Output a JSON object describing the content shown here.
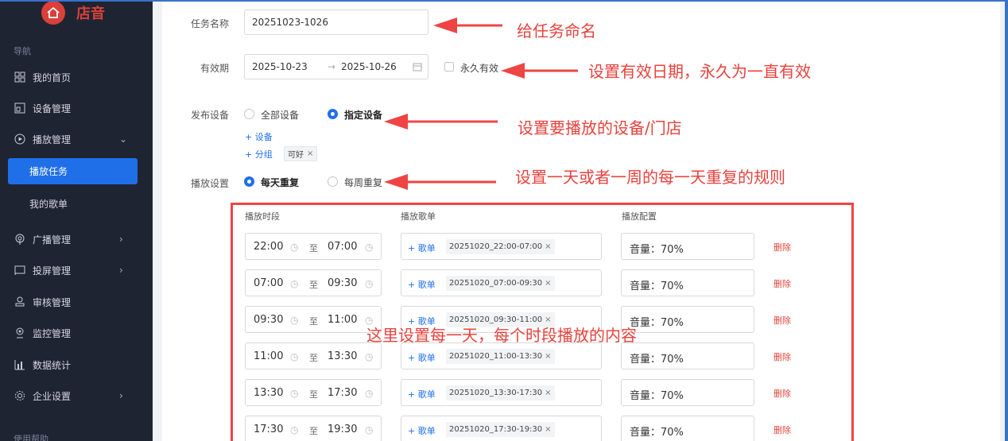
{
  "app": {
    "name": "店音"
  },
  "sidebar": {
    "section_nav": "导航",
    "items": [
      {
        "label": "我的首页",
        "icon": "grid-icon"
      },
      {
        "label": "设备管理",
        "icon": "device-icon"
      },
      {
        "label": "播放管理",
        "icon": "play-circle-icon",
        "arrow": "⌄"
      },
      {
        "label": "广播管理",
        "icon": "broadcast-icon",
        "arrow": "›"
      },
      {
        "label": "投屏管理",
        "icon": "cast-icon",
        "arrow": "›"
      },
      {
        "label": "审核管理",
        "icon": "stamp-icon"
      },
      {
        "label": "监控管理",
        "icon": "location-icon"
      },
      {
        "label": "数据统计",
        "icon": "bar-chart-icon"
      },
      {
        "label": "企业设置",
        "icon": "gear-icon",
        "arrow": "›"
      }
    ],
    "sub_active": "播放任务",
    "sub_other": "我的歌单",
    "section_help": "使用帮助"
  },
  "form": {
    "task_name_label": "任务名称",
    "task_name_value": "20251023-1026",
    "validity_label": "有效期",
    "date_start": "2025-10-23",
    "date_sep": "→",
    "date_end": "2025-10-26",
    "permanent_label": "永久有效",
    "publish_label": "发布设备",
    "all_devices": "全部设备",
    "specific_devices": "指定设备",
    "add_device": "+ 设备",
    "add_group": "+ 分组",
    "group_tag": "可好",
    "play_setting_label": "播放设置",
    "daily_repeat": "每天重复",
    "weekly_repeat": "每周重复"
  },
  "schedule": {
    "col_time": "播放时段",
    "col_playlist": "播放歌单",
    "col_config": "播放配置",
    "to": "至",
    "add_playlist": "+ 歌单",
    "delete": "删除",
    "rows": [
      {
        "start": "22:00",
        "end": "07:00",
        "playlist": "20251020_22:00-07:00",
        "volume": "音量：70%"
      },
      {
        "start": "07:00",
        "end": "09:30",
        "playlist": "20251020_07:00-09:30",
        "volume": "音量：70%"
      },
      {
        "start": "09:30",
        "end": "11:00",
        "playlist": "20251020_09:30-11:00",
        "volume": "音量：70%"
      },
      {
        "start": "11:00",
        "end": "13:30",
        "playlist": "20251020_11:00-13:30",
        "volume": "音量：70%"
      },
      {
        "start": "13:30",
        "end": "17:30",
        "playlist": "20251020_13:30-17:30",
        "volume": "音量：70%"
      },
      {
        "start": "17:30",
        "end": "19:30",
        "playlist": "20251020_17:30-19:30",
        "volume": "音量：70%"
      }
    ]
  },
  "annotations": {
    "name_task": "给任务命名",
    "set_validity": "设置有效日期，永久为一直有效",
    "set_devices": "设置要播放的设备/门店",
    "set_repeat": "设置一天或者一周的每一天重复的规则",
    "set_content": "这里设置每一天，每个时段播放的内容"
  },
  "colors": {
    "accent": "#1f6fe8",
    "brand": "#d9403a",
    "annotation": "#e8423d",
    "sidebar_bg": "#1f2433"
  }
}
